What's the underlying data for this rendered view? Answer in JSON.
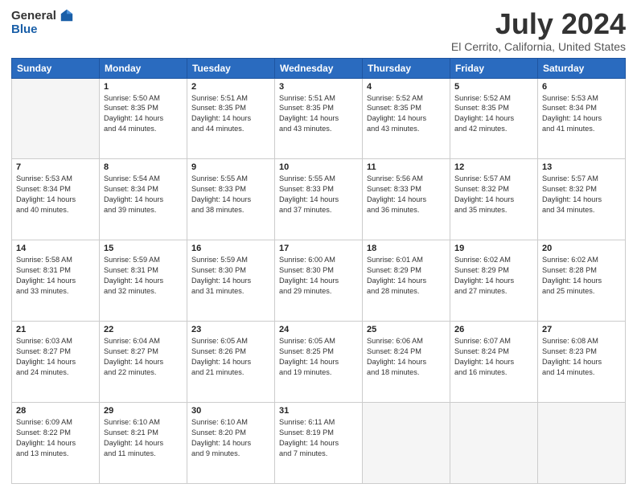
{
  "logo": {
    "general": "General",
    "blue": "Blue"
  },
  "title": "July 2024",
  "subtitle": "El Cerrito, California, United States",
  "weekdays": [
    "Sunday",
    "Monday",
    "Tuesday",
    "Wednesday",
    "Thursday",
    "Friday",
    "Saturday"
  ],
  "weeks": [
    [
      {
        "day": "",
        "empty": true
      },
      {
        "day": "1",
        "sunrise": "5:50 AM",
        "sunset": "8:35 PM",
        "daylight": "14 hours and 44 minutes."
      },
      {
        "day": "2",
        "sunrise": "5:51 AM",
        "sunset": "8:35 PM",
        "daylight": "14 hours and 44 minutes."
      },
      {
        "day": "3",
        "sunrise": "5:51 AM",
        "sunset": "8:35 PM",
        "daylight": "14 hours and 43 minutes."
      },
      {
        "day": "4",
        "sunrise": "5:52 AM",
        "sunset": "8:35 PM",
        "daylight": "14 hours and 43 minutes."
      },
      {
        "day": "5",
        "sunrise": "5:52 AM",
        "sunset": "8:35 PM",
        "daylight": "14 hours and 42 minutes."
      },
      {
        "day": "6",
        "sunrise": "5:53 AM",
        "sunset": "8:34 PM",
        "daylight": "14 hours and 41 minutes."
      }
    ],
    [
      {
        "day": "7",
        "sunrise": "5:53 AM",
        "sunset": "8:34 PM",
        "daylight": "14 hours and 40 minutes."
      },
      {
        "day": "8",
        "sunrise": "5:54 AM",
        "sunset": "8:34 PM",
        "daylight": "14 hours and 39 minutes."
      },
      {
        "day": "9",
        "sunrise": "5:55 AM",
        "sunset": "8:33 PM",
        "daylight": "14 hours and 38 minutes."
      },
      {
        "day": "10",
        "sunrise": "5:55 AM",
        "sunset": "8:33 PM",
        "daylight": "14 hours and 37 minutes."
      },
      {
        "day": "11",
        "sunrise": "5:56 AM",
        "sunset": "8:33 PM",
        "daylight": "14 hours and 36 minutes."
      },
      {
        "day": "12",
        "sunrise": "5:57 AM",
        "sunset": "8:32 PM",
        "daylight": "14 hours and 35 minutes."
      },
      {
        "day": "13",
        "sunrise": "5:57 AM",
        "sunset": "8:32 PM",
        "daylight": "14 hours and 34 minutes."
      }
    ],
    [
      {
        "day": "14",
        "sunrise": "5:58 AM",
        "sunset": "8:31 PM",
        "daylight": "14 hours and 33 minutes."
      },
      {
        "day": "15",
        "sunrise": "5:59 AM",
        "sunset": "8:31 PM",
        "daylight": "14 hours and 32 minutes."
      },
      {
        "day": "16",
        "sunrise": "5:59 AM",
        "sunset": "8:30 PM",
        "daylight": "14 hours and 31 minutes."
      },
      {
        "day": "17",
        "sunrise": "6:00 AM",
        "sunset": "8:30 PM",
        "daylight": "14 hours and 29 minutes."
      },
      {
        "day": "18",
        "sunrise": "6:01 AM",
        "sunset": "8:29 PM",
        "daylight": "14 hours and 28 minutes."
      },
      {
        "day": "19",
        "sunrise": "6:02 AM",
        "sunset": "8:29 PM",
        "daylight": "14 hours and 27 minutes."
      },
      {
        "day": "20",
        "sunrise": "6:02 AM",
        "sunset": "8:28 PM",
        "daylight": "14 hours and 25 minutes."
      }
    ],
    [
      {
        "day": "21",
        "sunrise": "6:03 AM",
        "sunset": "8:27 PM",
        "daylight": "14 hours and 24 minutes."
      },
      {
        "day": "22",
        "sunrise": "6:04 AM",
        "sunset": "8:27 PM",
        "daylight": "14 hours and 22 minutes."
      },
      {
        "day": "23",
        "sunrise": "6:05 AM",
        "sunset": "8:26 PM",
        "daylight": "14 hours and 21 minutes."
      },
      {
        "day": "24",
        "sunrise": "6:05 AM",
        "sunset": "8:25 PM",
        "daylight": "14 hours and 19 minutes."
      },
      {
        "day": "25",
        "sunrise": "6:06 AM",
        "sunset": "8:24 PM",
        "daylight": "14 hours and 18 minutes."
      },
      {
        "day": "26",
        "sunrise": "6:07 AM",
        "sunset": "8:24 PM",
        "daylight": "14 hours and 16 minutes."
      },
      {
        "day": "27",
        "sunrise": "6:08 AM",
        "sunset": "8:23 PM",
        "daylight": "14 hours and 14 minutes."
      }
    ],
    [
      {
        "day": "28",
        "sunrise": "6:09 AM",
        "sunset": "8:22 PM",
        "daylight": "14 hours and 13 minutes."
      },
      {
        "day": "29",
        "sunrise": "6:10 AM",
        "sunset": "8:21 PM",
        "daylight": "14 hours and 11 minutes."
      },
      {
        "day": "30",
        "sunrise": "6:10 AM",
        "sunset": "8:20 PM",
        "daylight": "14 hours and 9 minutes."
      },
      {
        "day": "31",
        "sunrise": "6:11 AM",
        "sunset": "8:19 PM",
        "daylight": "14 hours and 7 minutes."
      },
      {
        "day": "",
        "empty": true
      },
      {
        "day": "",
        "empty": true
      },
      {
        "day": "",
        "empty": true
      }
    ]
  ]
}
